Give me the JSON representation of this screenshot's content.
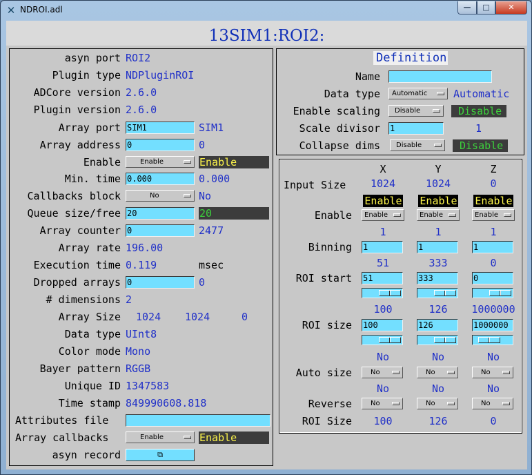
{
  "window": {
    "title": "NDROI.adl",
    "min_glyph": "—",
    "max_glyph": "□",
    "close_glyph": "✕",
    "app_glyph": "✕"
  },
  "header": {
    "title": "13SIM1:ROI2:"
  },
  "left": {
    "rows": [
      {
        "label": "asyn port",
        "value": "ROI2"
      },
      {
        "label": "Plugin type",
        "value": "NDPluginROI"
      },
      {
        "label": "ADCore version",
        "value": "2.6.0"
      },
      {
        "label": "Plugin version",
        "value": "2.6.0"
      }
    ],
    "array_port": {
      "label": "Array port",
      "input": "SIM1",
      "readback": "SIM1"
    },
    "array_address": {
      "label": "Array address",
      "input": "0",
      "readback": "0"
    },
    "enable": {
      "label": "Enable",
      "menu": "Enable",
      "readback": "Enable"
    },
    "min_time": {
      "label": "Min. time",
      "input": "0.000",
      "readback": "0.000"
    },
    "callbacks_block": {
      "label": "Callbacks block",
      "menu": "No",
      "readback": "No"
    },
    "queue": {
      "label": "Queue size/free",
      "input": "20",
      "readback": "20"
    },
    "array_counter": {
      "label": "Array counter",
      "input": "0",
      "readback": "2477"
    },
    "array_rate": {
      "label": "Array rate",
      "value": "196.00"
    },
    "execution_time": {
      "label": "Execution time",
      "value": "0.119",
      "unit": "msec"
    },
    "dropped_arrays": {
      "label": "Dropped arrays",
      "input": "0",
      "readback": "0"
    },
    "dimensions": {
      "label": "# dimensions",
      "value": "2"
    },
    "array_size": {
      "label": "Array Size",
      "x": "1024",
      "y": "1024",
      "z": "0"
    },
    "data_type": {
      "label": "Data type",
      "value": "UInt8"
    },
    "color_mode": {
      "label": "Color mode",
      "value": "Mono"
    },
    "bayer": {
      "label": "Bayer pattern",
      "value": "RGGB"
    },
    "unique_id": {
      "label": "Unique ID",
      "value": "1347583"
    },
    "time_stamp": {
      "label": "Time stamp",
      "value": "849990608.818"
    },
    "attributes_file": {
      "label": "Attributes file",
      "input": ""
    },
    "array_callbacks": {
      "label": "Array callbacks",
      "menu": "Enable",
      "readback": "Enable"
    },
    "asyn_record": {
      "label": "asyn record",
      "button_glyph": "⧉"
    }
  },
  "definition": {
    "title": "Definition",
    "name": {
      "label": "Name",
      "input": ""
    },
    "data_type": {
      "label": "Data type",
      "menu": "Automatic",
      "readback": "Automatic"
    },
    "enable_scaling": {
      "label": "Enable scaling",
      "menu": "Disable",
      "readback": "Disable"
    },
    "scale_divisor": {
      "label": "Scale divisor",
      "input": "1",
      "readback": "1"
    },
    "collapse_dims": {
      "label": "Collapse dims",
      "menu": "Disable",
      "readback": "Disable"
    }
  },
  "roi": {
    "columns": [
      "X",
      "Y",
      "Z"
    ],
    "input_size": {
      "label": "Input Size",
      "values": [
        "1024",
        "1024",
        "0"
      ]
    },
    "enable": {
      "label": "Enable",
      "readbacks": [
        "Enable",
        "Enable",
        "Enable"
      ],
      "menus": [
        "Enable",
        "Enable",
        "Enable"
      ]
    },
    "binning": {
      "label": "Binning",
      "readbacks": [
        "1",
        "1",
        "1"
      ],
      "inputs": [
        "1",
        "1",
        "1"
      ]
    },
    "roi_start": {
      "label": "ROI start",
      "readbacks": [
        "51",
        "333",
        "0"
      ],
      "inputs": [
        "51",
        "333",
        "0"
      ]
    },
    "roi_size": {
      "label": "ROI size",
      "readbacks": [
        "100",
        "126",
        "1000000"
      ],
      "inputs": [
        "100",
        "126",
        "1000000"
      ]
    },
    "auto_size": {
      "label": "Auto size",
      "readbacks": [
        "No",
        "No",
        "No"
      ],
      "menus": [
        "No",
        "No",
        "No"
      ]
    },
    "reverse": {
      "label": "Reverse",
      "readbacks": [
        "No",
        "No",
        "No"
      ],
      "menus": [
        "No",
        "No",
        "No"
      ]
    },
    "output_size": {
      "label": "ROI Size",
      "values": [
        "100",
        "126",
        "0"
      ]
    }
  }
}
